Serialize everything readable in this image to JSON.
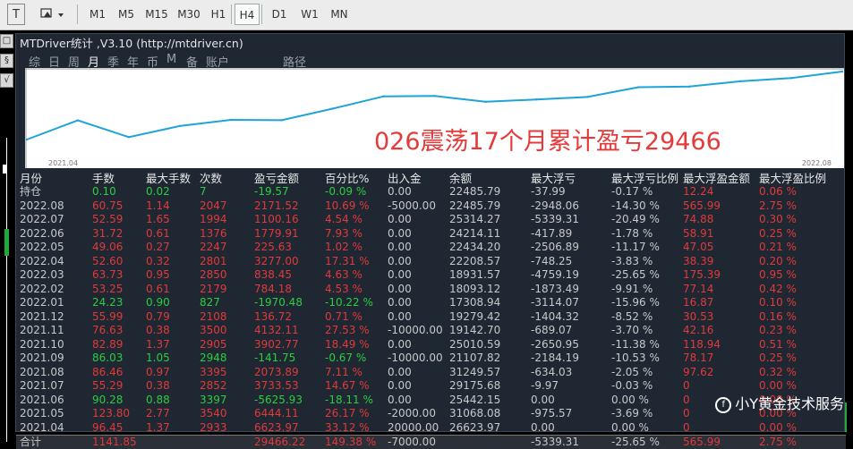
{
  "toolbar": {
    "text_tool": "T",
    "timeframes": [
      "M1",
      "M5",
      "M15",
      "M30",
      "H1",
      "H4",
      "D1",
      "W1",
      "MN"
    ],
    "active": "H4"
  },
  "left_strip": {
    "btn_top": "□",
    "btn_mid": "§",
    "btn_bottom": "√"
  },
  "panel": {
    "title": "MTDriver统计  ,V3.10 (http://mtdriver.cn)",
    "tabs": [
      "综",
      "日",
      "周",
      "月",
      "季",
      "年",
      "币",
      "M",
      "备",
      "账户",
      "路径"
    ],
    "active_tab": "月",
    "headline": "026震荡17个月累计盈亏29466"
  },
  "chart_data": {
    "type": "line",
    "x_start_label": "2021.04",
    "x_end_label": "2022.08",
    "x": [
      "2021.04",
      "2021.05",
      "2021.06",
      "2021.07",
      "2021.08",
      "2021.09",
      "2021.10",
      "2021.11",
      "2021.12",
      "2022.01",
      "2022.02",
      "2022.03",
      "2022.04",
      "2022.05",
      "2022.06",
      "2022.07",
      "2022.08"
    ],
    "series": [
      {
        "values": [
          6623.97,
          13068.08,
          7442.15,
          11175.68,
          13249.57,
          13107.82,
          17010.09,
          21142.7,
          21279.42,
          19308.94,
          20093.19,
          20931.85,
          24208.67,
          24434.2,
          26214.11,
          27314.27,
          29485.79
        ],
        "color": "#1fa3d8"
      }
    ]
  },
  "table": {
    "headers": [
      "月份",
      "手数",
      "最大手数",
      "次数",
      "盈亏金额",
      "百分比%",
      "出入金",
      "余额",
      "最大浮亏",
      "最大浮亏比例",
      "最大浮盈金额",
      "最大浮盈比例"
    ],
    "rows": [
      {
        "c": [
          "持仓",
          "0.10",
          "0.02",
          "7",
          "-19.57",
          "-0.09 %",
          "0.00",
          "22485.79",
          "-37.99",
          "-0.17 %",
          "12.24",
          "0.06 %"
        ],
        "g": 1
      },
      {
        "c": [
          "2022.08",
          "60.75",
          "1.14",
          "2047",
          "2171.52",
          "10.69 %",
          "-5000.00",
          "22485.79",
          "-2948.06",
          "-14.30 %",
          "565.99",
          "2.75 %"
        ],
        "g": 0
      },
      {
        "c": [
          "2022.07",
          "52.59",
          "1.65",
          "1994",
          "1100.16",
          "4.54 %",
          "0.00",
          "25314.27",
          "-5339.31",
          "-20.49 %",
          "74.88",
          "0.30 %"
        ],
        "g": 0
      },
      {
        "c": [
          "2022.06",
          "31.72",
          "0.61",
          "1376",
          "1779.91",
          "7.93 %",
          "0.00",
          "24214.11",
          "-417.89",
          "-1.78 %",
          "58.91",
          "0.25 %"
        ],
        "g": 0
      },
      {
        "c": [
          "2022.05",
          "49.06",
          "0.27",
          "2247",
          "225.63",
          "1.02 %",
          "0.00",
          "22434.20",
          "-2506.89",
          "-11.17 %",
          "47.05",
          "0.21 %"
        ],
        "g": 0
      },
      {
        "c": [
          "2022.04",
          "52.60",
          "0.32",
          "2801",
          "3277.00",
          "17.31 %",
          "0.00",
          "22208.57",
          "-748.25",
          "-3.83 %",
          "38.39",
          "0.20 %"
        ],
        "g": 0
      },
      {
        "c": [
          "2022.03",
          "63.73",
          "0.95",
          "2850",
          "838.45",
          "4.63 %",
          "0.00",
          "18931.57",
          "-4759.19",
          "-25.65 %",
          "175.39",
          "0.95 %"
        ],
        "g": 0
      },
      {
        "c": [
          "2022.02",
          "53.25",
          "0.61",
          "2179",
          "784.18",
          "4.53 %",
          "0.00",
          "18093.12",
          "-1873.49",
          "-9.91 %",
          "77.14",
          "0.42 %"
        ],
        "g": 0
      },
      {
        "c": [
          "2022.01",
          "24.23",
          "0.90",
          "827",
          "-1970.48",
          "-10.22 %",
          "0.00",
          "17308.94",
          "-3114.07",
          "-15.96 %",
          "16.87",
          "0.10 %"
        ],
        "g": 1
      },
      {
        "c": [
          "2021.12",
          "55.99",
          "0.79",
          "2108",
          "136.72",
          "0.71 %",
          "0.00",
          "19279.42",
          "-1404.32",
          "-8.52 %",
          "30.53",
          "0.16 %"
        ],
        "g": 0
      },
      {
        "c": [
          "2021.11",
          "76.63",
          "0.38",
          "3500",
          "4132.11",
          "27.53 %",
          "-10000.00",
          "19142.70",
          "-689.07",
          "-3.70 %",
          "42.16",
          "0.23 %"
        ],
        "g": 0
      },
      {
        "c": [
          "2021.10",
          "82.89",
          "1.37",
          "2905",
          "3902.77",
          "18.49 %",
          "0.00",
          "25010.59",
          "-2650.95",
          "-11.38 %",
          "118.94",
          "0.51 %"
        ],
        "g": 0
      },
      {
        "c": [
          "2021.09",
          "86.03",
          "1.05",
          "2948",
          "-141.75",
          "-0.67 %",
          "-10000.00",
          "21107.82",
          "-2184.19",
          "-10.53 %",
          "78.17",
          "0.25 %"
        ],
        "g": 1
      },
      {
        "c": [
          "2021.08",
          "86.46",
          "0.97",
          "3395",
          "2073.89",
          "7.11 %",
          "0.00",
          "31249.57",
          "-634.03",
          "-2.05 %",
          "97.62",
          "0.32 %"
        ],
        "g": 0
      },
      {
        "c": [
          "2021.07",
          "55.29",
          "0.38",
          "2852",
          "3733.53",
          "14.67 %",
          "0.00",
          "29175.68",
          "-9.97",
          "-0.03 %",
          "0",
          "0.00 %"
        ],
        "g": 0
      },
      {
        "c": [
          "2021.06",
          "90.28",
          "0.88",
          "3397",
          "-5625.93",
          "-18.11 %",
          "0.00",
          "25442.15",
          "0.00",
          "0.00 %",
          "0",
          "0.00 %"
        ],
        "g": 1
      },
      {
        "c": [
          "2021.05",
          "123.80",
          "2.77",
          "3540",
          "6444.11",
          "26.17 %",
          "-2000.00",
          "31068.08",
          "-975.57",
          "-3.69 %",
          "0",
          "0.00 %"
        ],
        "g": 0
      },
      {
        "c": [
          "2021.04",
          "96.45",
          "1.37",
          "2933",
          "6623.97",
          "33.12 %",
          "20000.00",
          "26623.97",
          "0.00",
          "0.00 %",
          "0",
          "0.00 %"
        ],
        "g": 0
      }
    ],
    "summary": [
      "合计",
      "1141.85",
      "",
      "",
      "29466.22",
      "149.38 %",
      "-7000.00",
      "",
      "-5339.31",
      "-25.65 %",
      "565.99",
      "2.75 %"
    ]
  },
  "colors": {
    "red": "#e03a3a",
    "green": "#2ecc40",
    "gray": "#c8c8c8",
    "line": "#1fa3d8"
  },
  "watermark": {
    "icon": "f",
    "text": "小Y黄金技术服务"
  }
}
